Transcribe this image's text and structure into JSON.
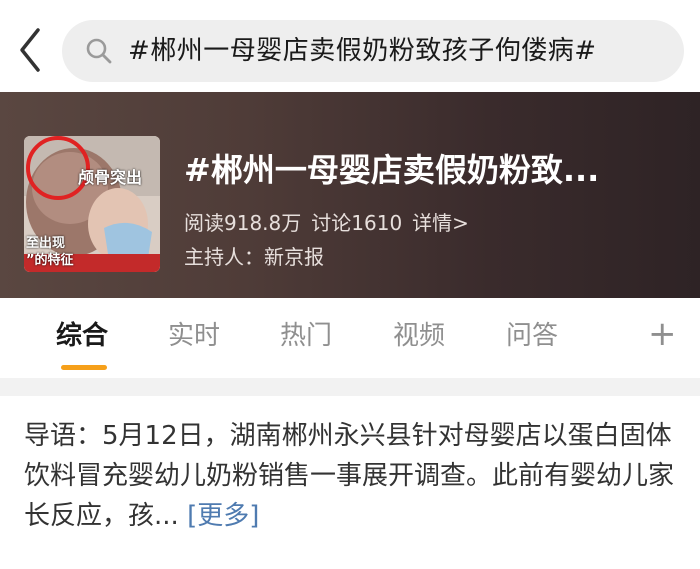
{
  "search": {
    "query": "#郴州一母婴店卖假奶粉致孩子佝偻病#"
  },
  "banner": {
    "thumbnail_captions": [
      "颅骨突出",
      "至出现",
      "”的特征"
    ],
    "title": "#郴州一母婴店卖假奶粉致...",
    "reads": "阅读918.8万",
    "discussions": "讨论1610",
    "details": "详情>",
    "host": "主持人：新京报"
  },
  "tabs": [
    {
      "label": "综合",
      "active": true
    },
    {
      "label": "实时",
      "active": false
    },
    {
      "label": "热门",
      "active": false
    },
    {
      "label": "视频",
      "active": false
    },
    {
      "label": "问答",
      "active": false
    }
  ],
  "tabs_more": "+",
  "intro": {
    "text": "导语：5月12日，湖南郴州永兴县针对母婴店以蛋白固体饮料冒充婴幼儿奶粉销售一事展开调查。此前有婴幼儿家长反应，孩... ",
    "more_label": "[更多]"
  },
  "colors": {
    "tab_accent": "#f6a01a",
    "link": "#4f7bb0",
    "banner_bg": "#4f3c38"
  },
  "icons": [
    "back-arrow-icon",
    "search-icon",
    "plus-icon"
  ]
}
